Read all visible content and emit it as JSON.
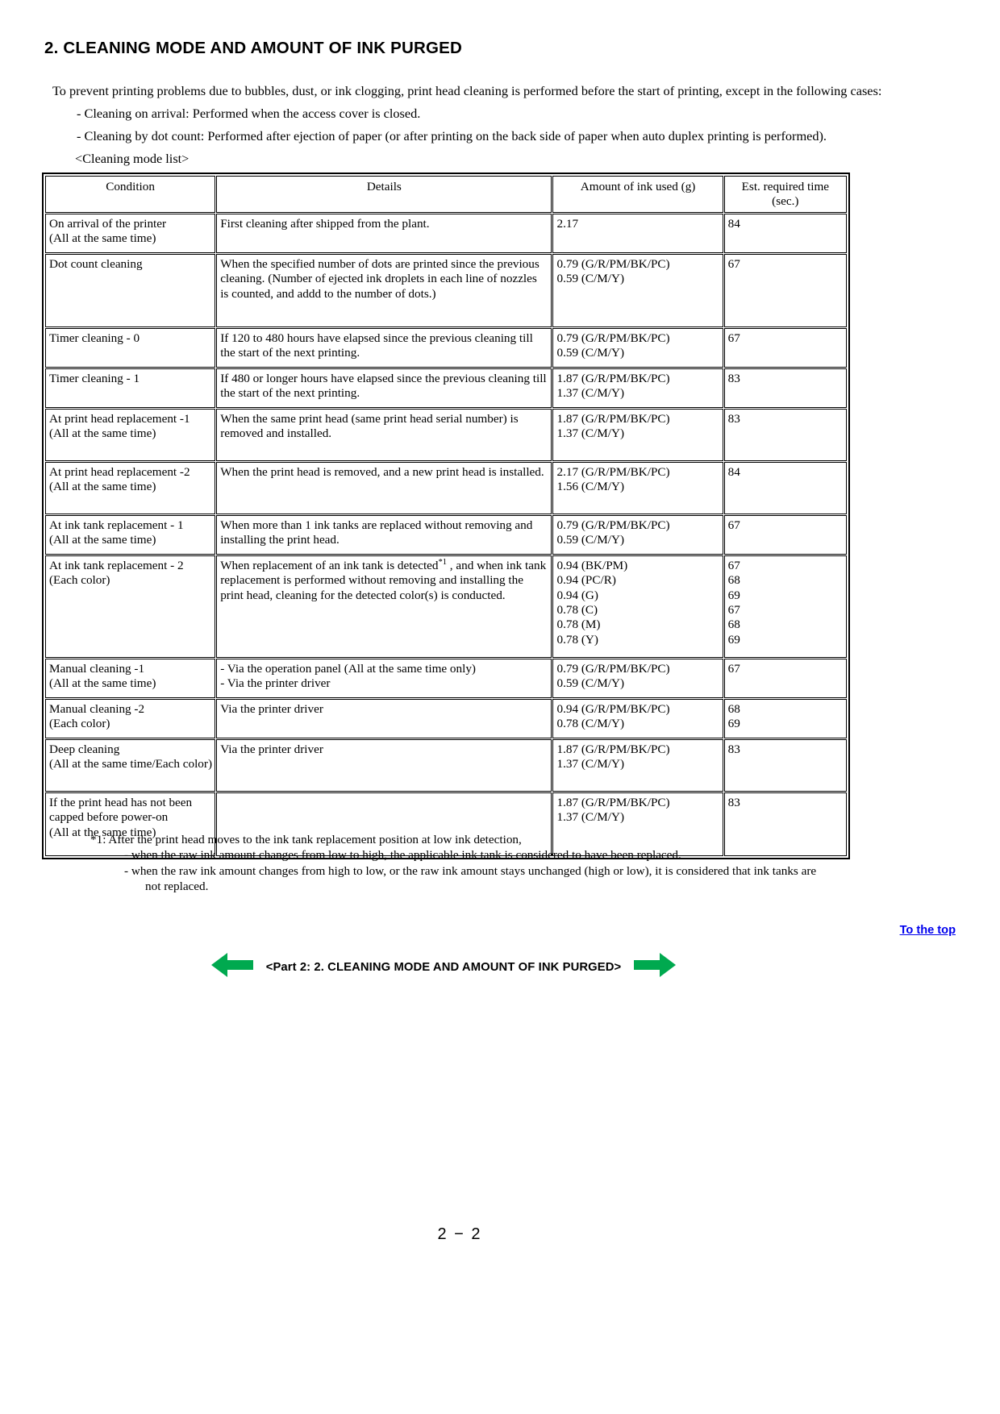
{
  "heading": "2.  CLEANING MODE AND AMOUNT OF INK PURGED",
  "intro": {
    "lead": "To prevent printing problems due to bubbles, dust, or ink clogging, print head cleaning is performed before the start of printing, except in the following cases:",
    "bullet1": "- Cleaning on arrival:  Performed when the access cover is closed.",
    "bullet2": "- Cleaning by dot count:  Performed after ejection of paper (or after printing on the back side of paper when auto duplex printing is performed).",
    "list_label": "<Cleaning mode list>"
  },
  "table": {
    "headers": {
      "condition": "Condition",
      "details": "Details",
      "ink": "Amount of ink used (g)",
      "time": "Est. required time (sec.)"
    },
    "rows": [
      {
        "condition": [
          "On arrival of the printer",
          "(All at the same time)"
        ],
        "details": [
          "First cleaning after shipped from the plant."
        ],
        "ink": [
          "2.17"
        ],
        "time": [
          "84"
        ]
      },
      {
        "condition": [
          "Dot count cleaning"
        ],
        "details": [
          "When the specified number of dots are printed since the previous cleaning. (Number of ejected ink droplets in each line of nozzles is counted, and addd to the number of dots.)"
        ],
        "ink": [
          "0.79 (G/R/PM/BK/PC)",
          "0.59 (C/M/Y)"
        ],
        "time": [
          "67"
        ]
      },
      {
        "condition": [
          "Timer cleaning - 0"
        ],
        "details": [
          "If 120 to 480 hours have elapsed since the previous cleaning till the start of the next printing."
        ],
        "ink": [
          "0.79 (G/R/PM/BK/PC)",
          "0.59 (C/M/Y)"
        ],
        "time": [
          "67"
        ]
      },
      {
        "condition": [
          "Timer cleaning - 1"
        ],
        "details": [
          "If 480 or longer hours have elapsed since the previous cleaning till the start of the next printing."
        ],
        "ink": [
          "1.87 (G/R/PM/BK/PC)",
          "1.37 (C/M/Y)"
        ],
        "time": [
          "83"
        ]
      },
      {
        "condition": [
          "At print head replacement -1",
          "(All at the same time)"
        ],
        "details": [
          "When the same print head (same print head serial number) is removed and installed."
        ],
        "ink": [
          "1.87 (G/R/PM/BK/PC)",
          "1.37 (C/M/Y)"
        ],
        "time": [
          "83"
        ]
      },
      {
        "condition": [
          "At print head replacement -2",
          "(All at the same time)"
        ],
        "details": [
          "When the print head is removed, and a new print head is installed."
        ],
        "ink": [
          "2.17 (G/R/PM/BK/PC)",
          "1.56 (C/M/Y)"
        ],
        "time": [
          "84"
        ]
      },
      {
        "condition": [
          "At ink tank replacement - 1",
          "(All at the same time)"
        ],
        "details": [
          "When more than 1 ink tanks are replaced without removing and installing the print head."
        ],
        "ink": [
          "0.79 (G/R/PM/BK/PC)",
          "0.59 (C/M/Y)"
        ],
        "time": [
          "67"
        ]
      },
      {
        "condition": [
          "At ink tank replacement - 2",
          "(Each color)"
        ],
        "details_pre": "When replacement of an ink tank is detected",
        "details_sup": "*1",
        "details_post": " , and when ink tank replacement is performed without removing and installing the print head, cleaning for the detected color(s) is conducted.",
        "ink": [
          "0.94 (BK/PM)",
          "0.94 (PC/R)",
          "0.94 (G)",
          "0.78 (C)",
          "0.78 (M)",
          "0.78 (Y)"
        ],
        "time": [
          "67",
          "68",
          "69",
          "67",
          "68",
          "69"
        ]
      },
      {
        "condition": [
          "Manual cleaning -1",
          "(All at the same time)"
        ],
        "details": [
          "- Via the operation panel (All at the same time only)",
          "- Via the printer driver"
        ],
        "ink": [
          "0.79 (G/R/PM/BK/PC)",
          "0.59 (C/M/Y)"
        ],
        "time": [
          "67"
        ]
      },
      {
        "condition": [
          "Manual cleaning -2",
          "(Each color)"
        ],
        "details": [
          "Via the printer driver"
        ],
        "ink": [
          "0.94 (G/R/PM/BK/PC)",
          "0.78 (C/M/Y)"
        ],
        "time": [
          "68",
          "69"
        ]
      },
      {
        "condition": [
          "Deep cleaning",
          "(All at the same time/Each color)"
        ],
        "details": [
          "Via the printer driver"
        ],
        "ink": [
          "1.87 (G/R/PM/BK/PC)",
          "1.37 (C/M/Y)"
        ],
        "time": [
          "83"
        ]
      },
      {
        "condition": [
          "If the print head has not been",
          "capped before power-on",
          "(All at the same time)"
        ],
        "details": [
          ""
        ],
        "ink": [
          "1.87 (G/R/PM/BK/PC)",
          "1.37 (C/M/Y)"
        ],
        "time": [
          "83"
        ]
      }
    ]
  },
  "footnote": {
    "line1": "*1:  After the print head moves to the ink tank replacement position at low ink detection,",
    "line2": "- when the raw ink amount changes from low to high, the applicable ink tank is considered to have been replaced.",
    "line3": "- when the raw ink amount changes from high to low, or the raw ink amount stays unchanged (high or low), it is considered that ink tanks are",
    "line4": "not replaced."
  },
  "to_top": "To the top",
  "nav": {
    "label": "<Part 2:  2. CLEANING MODE AND AMOUNT OF INK PURGED>",
    "arrow_color": "#00A94F"
  },
  "page_number": "2 − 2"
}
